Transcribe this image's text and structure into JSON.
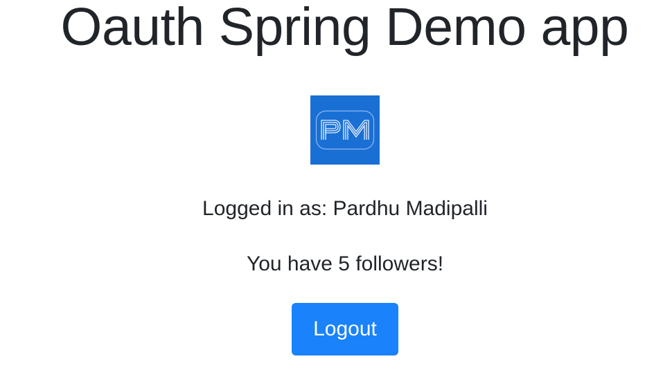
{
  "header": {
    "title": "Oauth Spring Demo app"
  },
  "profile": {
    "avatar_text": "PM",
    "avatar_color": "#1a6fd4",
    "logged_in_text": "Logged in as: Pardhu Madipalli",
    "followers_text": "You have 5 followers!"
  },
  "actions": {
    "logout_label": "Logout",
    "logout_color": "#1a82fa"
  }
}
